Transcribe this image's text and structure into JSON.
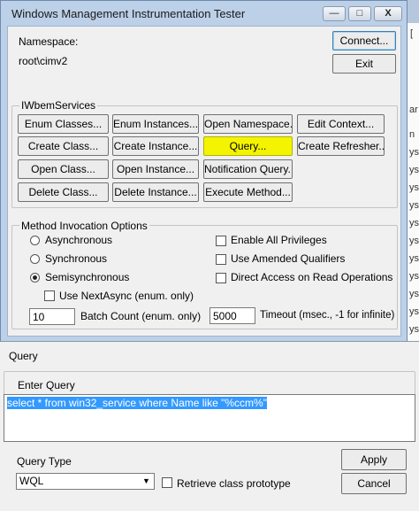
{
  "wmi_window": {
    "title": "Windows Management Instrumentation Tester",
    "namespace_label": "Namespace:",
    "namespace_value": "root\\cimv2",
    "connect_label": "Connect...",
    "exit_label": "Exit",
    "iwbem_group_label": "IWbemServices",
    "iwbem_buttons": [
      "Enum Classes...",
      "Enum Instances...",
      "Open Namespace...",
      "Edit Context...",
      "Create Class...",
      "Create Instance...",
      "Query...",
      "Create Refresher...",
      "Open Class...",
      "Open Instance...",
      "Notification Query...",
      "Delete Class...",
      "Delete Instance...",
      "Execute Method..."
    ],
    "method_group_label": "Method Invocation Options",
    "asynchronous_label": "Asynchronous",
    "synchronous_label": "Synchronous",
    "semisynchronous_label": "Semisynchronous",
    "use_next_async_label": "Use NextAsync (enum. only)",
    "enable_privileges_label": "Enable All Privileges",
    "amended_qualifiers_label": "Use Amended Qualifiers",
    "direct_access_label": "Direct Access on Read Operations",
    "batch_count_value": "10",
    "batch_count_label": "Batch Count (enum. only)",
    "timeout_value": "5000",
    "timeout_label": "Timeout (msec., -1 for infinite)",
    "minimize_glyph": "—",
    "maximize_glyph": "□",
    "close_glyph": "X"
  },
  "background_window": {
    "fragments": [
      "[",
      "ar",
      "n",
      "ys",
      "ys",
      "ys",
      "ys",
      "ys",
      "ys",
      "ys",
      "ys",
      "ys",
      "ys",
      "ys",
      "k"
    ]
  },
  "query_dialog": {
    "title": "Query",
    "enter_query_label": "Enter Query",
    "query_text": "select * from win32_service where Name like \"%ccm%\"",
    "query_type_label": "Query Type",
    "query_type_value": "WQL",
    "retrieve_prototype_label": "Retrieve class prototype",
    "apply_label": "Apply",
    "cancel_label": "Cancel"
  },
  "colors": {
    "highlight": "#f4f400",
    "selection": "#3399ff",
    "dialog_bg": "#f0f0f0"
  }
}
